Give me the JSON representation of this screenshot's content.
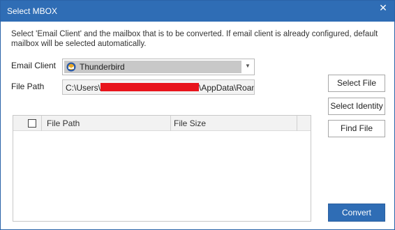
{
  "window": {
    "title": "Select MBOX",
    "close_glyph": "✕"
  },
  "instruction": "Select 'Email Client' and the mailbox that is to be converted. If email client is already configured, default mailbox will be selected automatically.",
  "form": {
    "email_client_label": "Email Client",
    "email_client_value": "Thunderbird",
    "email_client_icon": "thunderbird-icon",
    "file_path_label": "File Path",
    "file_path_prefix": "C:\\Users\\",
    "file_path_suffix": "\\AppData\\Roamin"
  },
  "buttons": {
    "select_file": "Select File",
    "select_identity": "Select Identity",
    "find_file": "Find File",
    "convert": "Convert"
  },
  "table": {
    "columns": [
      "File Path",
      "File Size"
    ],
    "rows": []
  },
  "colors": {
    "accent": "#2f6db5",
    "redaction": "#e8141c"
  }
}
